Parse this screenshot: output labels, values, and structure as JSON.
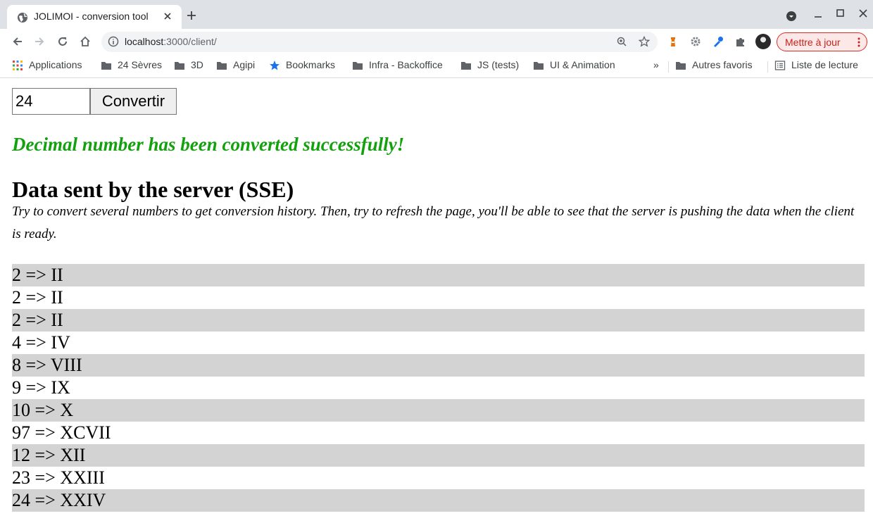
{
  "browser": {
    "tab_title": "JOLIMOI - conversion tool",
    "url_host": "localhost",
    "url_rest": ":3000/client/",
    "update_button": "Mettre à jour",
    "bookmarks": [
      {
        "label": "Applications",
        "icon": "apps-grid-icon"
      },
      {
        "label": "24 Sèvres",
        "icon": "folder-icon"
      },
      {
        "label": "3D",
        "icon": "folder-icon"
      },
      {
        "label": "Agipi",
        "icon": "folder-icon"
      },
      {
        "label": "Bookmarks",
        "icon": "star-icon"
      },
      {
        "label": "Infra - Backoffice",
        "icon": "folder-icon"
      },
      {
        "label": "JS (tests)",
        "icon": "folder-icon"
      },
      {
        "label": "UI & Animation",
        "icon": "folder-icon"
      }
    ],
    "more_bookmarks": "»",
    "other_bookmarks": "Autres favoris",
    "reading_list": "Liste de lecture",
    "colors": {
      "tabstrip": "#dee1e6",
      "update_accent": "#d93025"
    }
  },
  "form": {
    "input_value": "24",
    "submit_label": "Convertir"
  },
  "message": {
    "success_text": "Decimal number has been converted successfully!",
    "success_color": "#13a10e"
  },
  "section": {
    "title": "Data sent by the server (SSE)",
    "description": "Try to convert several numbers to get conversion history. Then, try to refresh the page, you'll be able to see that the server is pushing the data when the client is ready."
  },
  "history": [
    "2 => II",
    "2 => II",
    "2 => II",
    "4 => IV",
    "8 => VIII",
    "9 => IX",
    "10 => X",
    "97 => XCVII",
    "12 => XII",
    "23 => XXIII",
    "24 => XXIV"
  ]
}
